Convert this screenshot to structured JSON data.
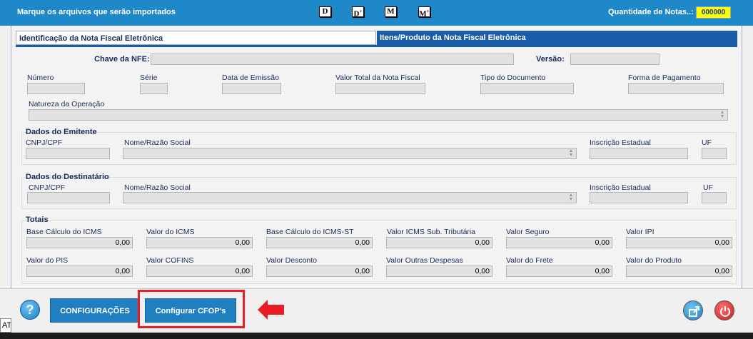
{
  "header": {
    "title": "Marque os arquivos que serão importados",
    "hotkeys": [
      "D",
      "D",
      "M",
      "M"
    ],
    "quantity_label": "Quantidade de Notas..:",
    "quantity_value": "000000"
  },
  "tabs": [
    {
      "label": "Identificação da Nota Fiscal Eletrônica",
      "active": true
    },
    {
      "label": "Itens/Produto da Nota Fiscal Eletrônica",
      "active": false
    }
  ],
  "nfe": {
    "chave_label": "Chave da NFE:",
    "versao_label": "Versão:",
    "numero_label": "Número",
    "serie_label": "Série",
    "data_emissao_label": "Data de Emissão",
    "valor_total_label": "Valor Total da Nota Fiscal",
    "tipo_documento_label": "Tipo do Documento",
    "forma_pagamento_label": "Forma de Pagamento",
    "natureza_label": "Natureza da Operação"
  },
  "emitente": {
    "title": "Dados do Emitente",
    "cnpj_label": "CNPJ/CPF",
    "nome_label": "Nome/Razão Social",
    "ie_label": "Inscrição Estadual",
    "uf_label": "UF"
  },
  "destinatario": {
    "title": "Dados do Destinatário",
    "cnpj_label": "CNPJ/CPF",
    "nome_label": "Nome/Razão Social",
    "ie_label": "Inscrição Estadual",
    "uf_label": "UF"
  },
  "totais": {
    "title": "Totais",
    "row1": [
      {
        "label": "Base Cálculo do ICMS",
        "value": "0,00"
      },
      {
        "label": "Valor do ICMS",
        "value": "0,00"
      },
      {
        "label": "Base Cálculo do ICMS-ST",
        "value": "0,00"
      },
      {
        "label": "Valor ICMS Sub. Tributária",
        "value": "0,00"
      },
      {
        "label": "Valor Seguro",
        "value": "0,00"
      },
      {
        "label": "Valor IPI",
        "value": "0,00"
      }
    ],
    "row2": [
      {
        "label": "Valor do PIS",
        "value": "0,00"
      },
      {
        "label": "Valor COFINS",
        "value": "0,00"
      },
      {
        "label": "Valor Desconto",
        "value": "0,00"
      },
      {
        "label": "Valor Outras Despesas",
        "value": "0,00"
      },
      {
        "label": "Valor do Frete",
        "value": "0,00"
      },
      {
        "label": "Valor do Produto",
        "value": "0,00"
      }
    ]
  },
  "footer": {
    "help_symbol": "?",
    "config_label": "CONFIGURAÇÕES",
    "cfop_label": "Configurar CFOP's",
    "edge_text": "AT"
  },
  "colors": {
    "header_blue": "#1e88c8",
    "tab_blue": "#1a5ca8",
    "highlight_red": "#e81c24",
    "quantity_yellow": "#ffff00"
  }
}
